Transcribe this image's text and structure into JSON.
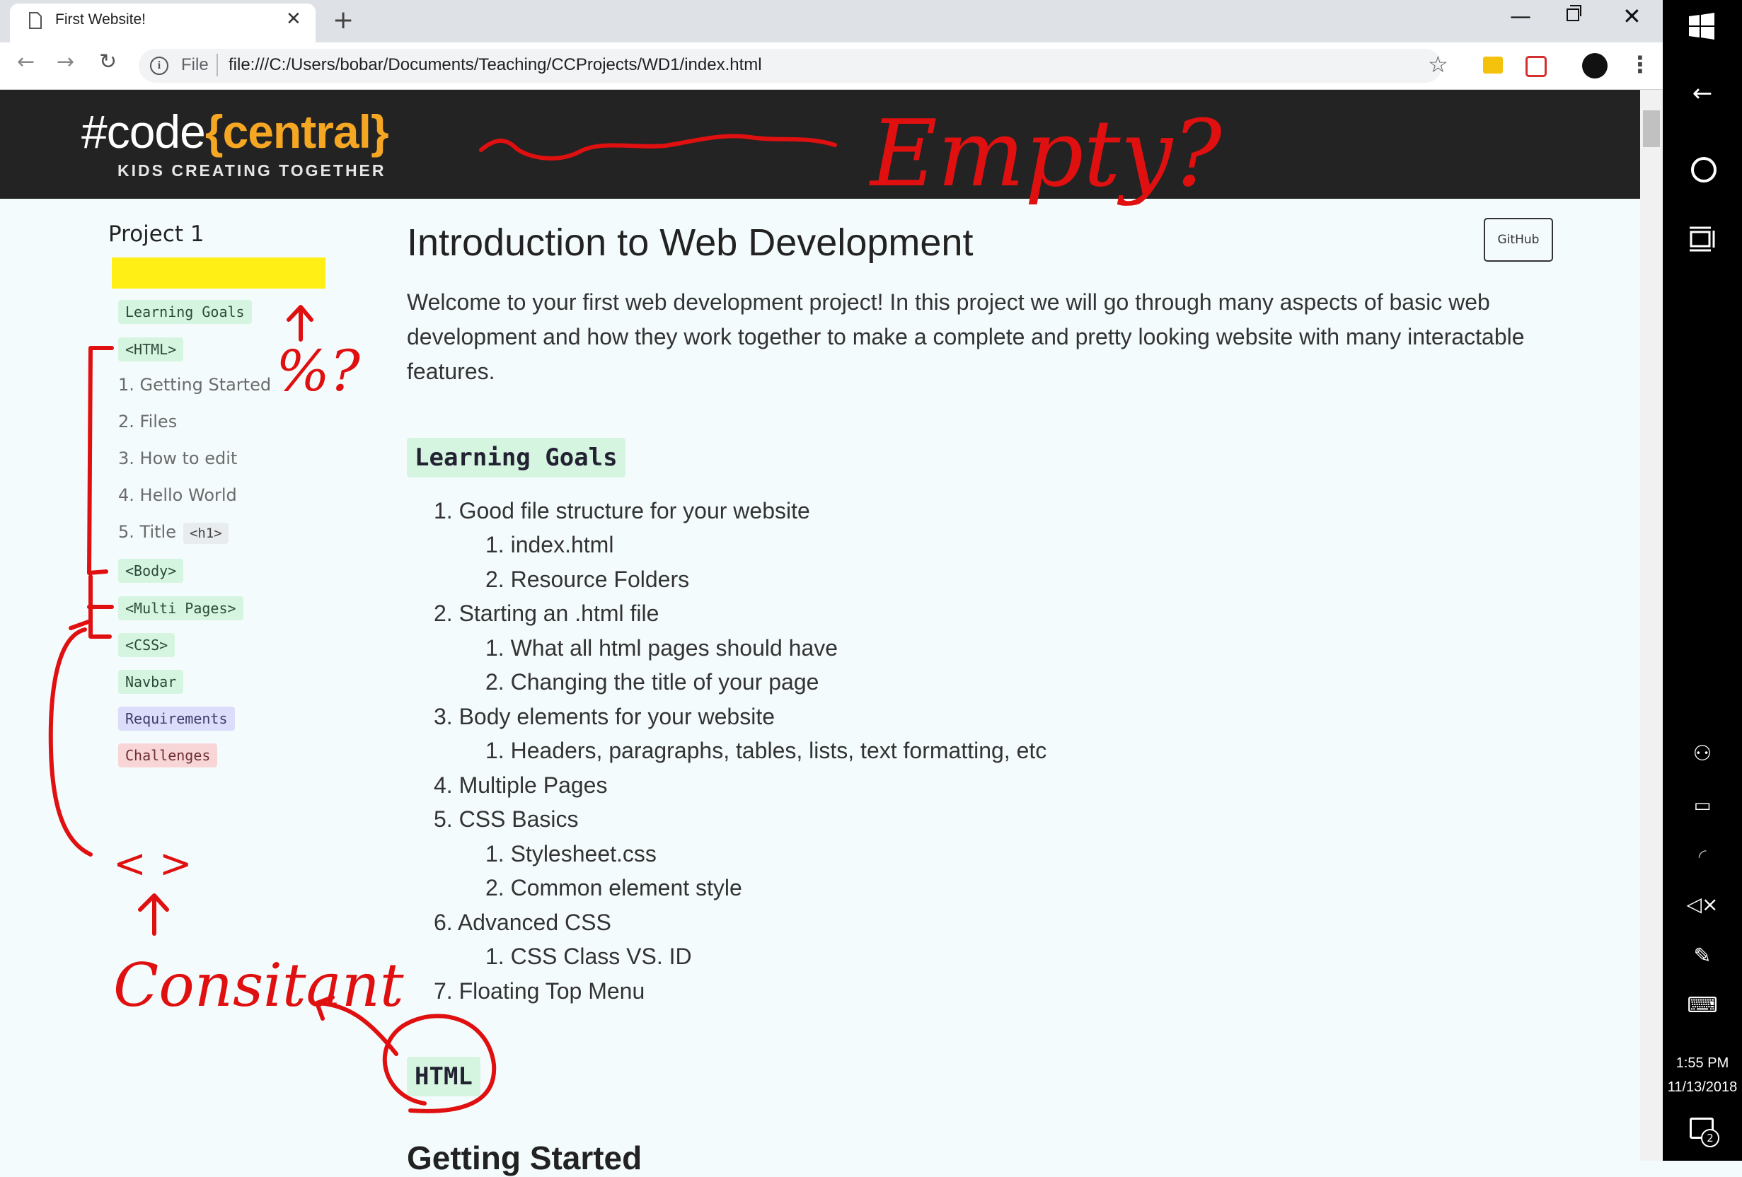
{
  "browser": {
    "tab_title": "First Website!",
    "tab_close": "✕",
    "new_tab": "+",
    "scheme_label": "File",
    "url": "file:///C:/Users/bobar/Documents/Teaching/CCProjects/WD1/index.html",
    "window_controls": {
      "minimize": "—",
      "close": "✕"
    }
  },
  "header": {
    "logo_prefix": "#code",
    "logo_accent": "{central}",
    "tagline": "KIDS CREATING TOGETHER",
    "colors": {
      "background": "#232323",
      "accent": "#f5a623"
    }
  },
  "sidebar": {
    "project_title": "Project 1",
    "items": [
      {
        "label": "Learning Goals",
        "type": "chip"
      },
      {
        "label": "<HTML>",
        "type": "chip"
      },
      {
        "label": "1. Getting Started",
        "type": "link"
      },
      {
        "label": "2. Files",
        "type": "link"
      },
      {
        "label": "3. How to edit",
        "type": "link"
      },
      {
        "label": "4. Hello World",
        "type": "link"
      },
      {
        "label": "5. Title",
        "type": "link",
        "code": "<h1>"
      },
      {
        "label": "<Body>",
        "type": "chip"
      },
      {
        "label": "<Multi Pages>",
        "type": "chip"
      },
      {
        "label": "<CSS>",
        "type": "chip"
      },
      {
        "label": "Navbar",
        "type": "chip"
      },
      {
        "label": "Requirements",
        "type": "chip",
        "color": "#dcdcfb"
      },
      {
        "label": "Challenges",
        "type": "chip",
        "color": "#f8d6d8"
      }
    ]
  },
  "main": {
    "title": "Introduction to Web Development",
    "github_label": "GitHub",
    "intro": "Welcome to your first web development project! In this project we will go through many aspects of basic web development and how they work together to make a complete and pretty looking website with many interactable features.",
    "learning_goals_heading": "Learning Goals",
    "goals": [
      "1. Good file structure for your website",
      "1. index.html",
      "2. Resource Folders",
      "2. Starting an .html file",
      "1. What all html pages should have",
      "2. Changing the title of your page",
      "3. Body elements for your website",
      "1. Headers, paragraphs, tables, lists, text formatting, etc",
      "4. Multiple Pages",
      "5. CSS Basics",
      "1. Stylesheet.css",
      "2. Common element style",
      "6. Advanced CSS",
      "1. CSS Class VS. ID",
      "7. Floating Top Menu"
    ],
    "html_heading": "HTML",
    "next_heading": "Getting Started"
  },
  "annotations": {
    "empty_note": "Empty?",
    "percent_note": "%?",
    "brackets_note": "< >",
    "consistent_note": "Consitant",
    "ink_color": "#e01010",
    "highlight_color": "#ffee00"
  },
  "taskbar": {
    "time": "1:55 PM",
    "date": "11/13/2018",
    "notification_count": "2"
  }
}
